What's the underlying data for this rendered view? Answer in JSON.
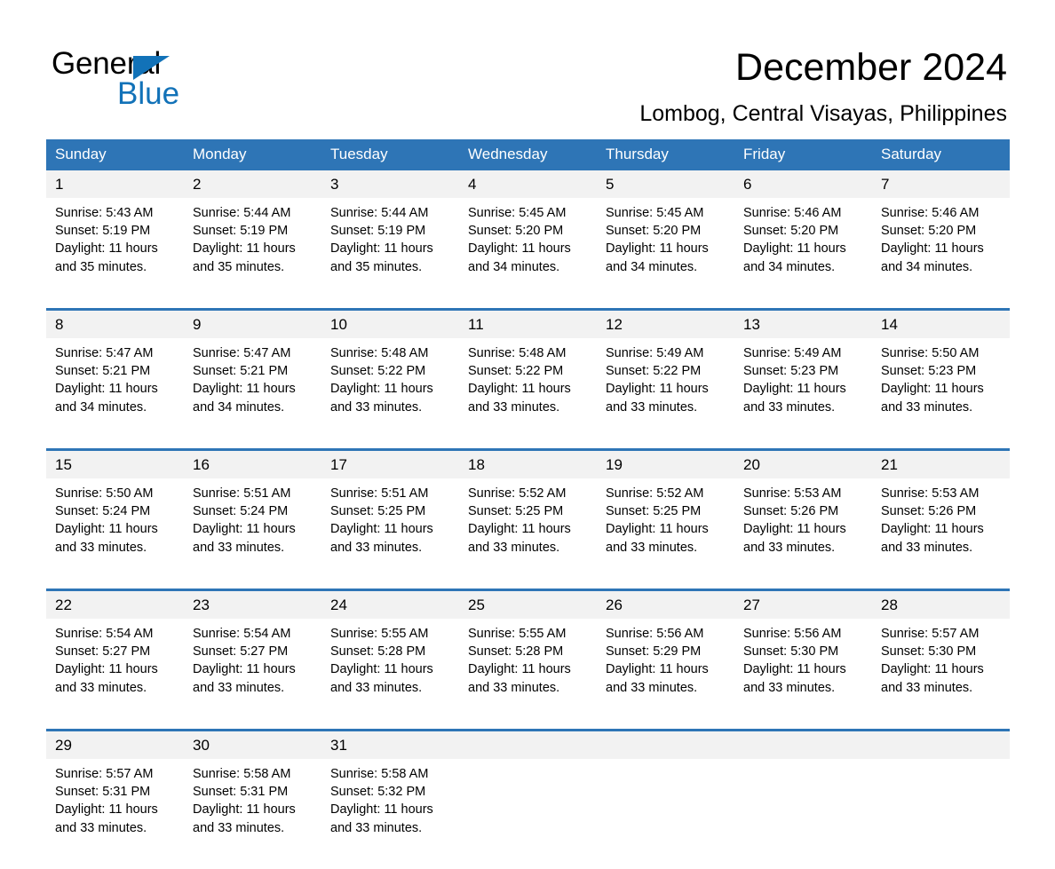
{
  "logo": {
    "word1": "General",
    "word2": "Blue",
    "accent_color": "#1272b8",
    "triangle_icon": "triangle-icon"
  },
  "header": {
    "title": "December 2024",
    "location": "Lombog, Central Visayas, Philippines"
  },
  "theme": {
    "header_blue": "#2e75b6",
    "daynum_band": "#f2f2f2",
    "text": "#000000"
  },
  "calendar": {
    "weekday_headers": [
      "Sunday",
      "Monday",
      "Tuesday",
      "Wednesday",
      "Thursday",
      "Friday",
      "Saturday"
    ],
    "weeks": [
      {
        "days": [
          {
            "num": "1",
            "sunrise": "Sunrise: 5:43 AM",
            "sunset": "Sunset: 5:19 PM",
            "daylight1": "Daylight: 11 hours",
            "daylight2": "and 35 minutes."
          },
          {
            "num": "2",
            "sunrise": "Sunrise: 5:44 AM",
            "sunset": "Sunset: 5:19 PM",
            "daylight1": "Daylight: 11 hours",
            "daylight2": "and 35 minutes."
          },
          {
            "num": "3",
            "sunrise": "Sunrise: 5:44 AM",
            "sunset": "Sunset: 5:19 PM",
            "daylight1": "Daylight: 11 hours",
            "daylight2": "and 35 minutes."
          },
          {
            "num": "4",
            "sunrise": "Sunrise: 5:45 AM",
            "sunset": "Sunset: 5:20 PM",
            "daylight1": "Daylight: 11 hours",
            "daylight2": "and 34 minutes."
          },
          {
            "num": "5",
            "sunrise": "Sunrise: 5:45 AM",
            "sunset": "Sunset: 5:20 PM",
            "daylight1": "Daylight: 11 hours",
            "daylight2": "and 34 minutes."
          },
          {
            "num": "6",
            "sunrise": "Sunrise: 5:46 AM",
            "sunset": "Sunset: 5:20 PM",
            "daylight1": "Daylight: 11 hours",
            "daylight2": "and 34 minutes."
          },
          {
            "num": "7",
            "sunrise": "Sunrise: 5:46 AM",
            "sunset": "Sunset: 5:20 PM",
            "daylight1": "Daylight: 11 hours",
            "daylight2": "and 34 minutes."
          }
        ]
      },
      {
        "days": [
          {
            "num": "8",
            "sunrise": "Sunrise: 5:47 AM",
            "sunset": "Sunset: 5:21 PM",
            "daylight1": "Daylight: 11 hours",
            "daylight2": "and 34 minutes."
          },
          {
            "num": "9",
            "sunrise": "Sunrise: 5:47 AM",
            "sunset": "Sunset: 5:21 PM",
            "daylight1": "Daylight: 11 hours",
            "daylight2": "and 34 minutes."
          },
          {
            "num": "10",
            "sunrise": "Sunrise: 5:48 AM",
            "sunset": "Sunset: 5:22 PM",
            "daylight1": "Daylight: 11 hours",
            "daylight2": "and 33 minutes."
          },
          {
            "num": "11",
            "sunrise": "Sunrise: 5:48 AM",
            "sunset": "Sunset: 5:22 PM",
            "daylight1": "Daylight: 11 hours",
            "daylight2": "and 33 minutes."
          },
          {
            "num": "12",
            "sunrise": "Sunrise: 5:49 AM",
            "sunset": "Sunset: 5:22 PM",
            "daylight1": "Daylight: 11 hours",
            "daylight2": "and 33 minutes."
          },
          {
            "num": "13",
            "sunrise": "Sunrise: 5:49 AM",
            "sunset": "Sunset: 5:23 PM",
            "daylight1": "Daylight: 11 hours",
            "daylight2": "and 33 minutes."
          },
          {
            "num": "14",
            "sunrise": "Sunrise: 5:50 AM",
            "sunset": "Sunset: 5:23 PM",
            "daylight1": "Daylight: 11 hours",
            "daylight2": "and 33 minutes."
          }
        ]
      },
      {
        "days": [
          {
            "num": "15",
            "sunrise": "Sunrise: 5:50 AM",
            "sunset": "Sunset: 5:24 PM",
            "daylight1": "Daylight: 11 hours",
            "daylight2": "and 33 minutes."
          },
          {
            "num": "16",
            "sunrise": "Sunrise: 5:51 AM",
            "sunset": "Sunset: 5:24 PM",
            "daylight1": "Daylight: 11 hours",
            "daylight2": "and 33 minutes."
          },
          {
            "num": "17",
            "sunrise": "Sunrise: 5:51 AM",
            "sunset": "Sunset: 5:25 PM",
            "daylight1": "Daylight: 11 hours",
            "daylight2": "and 33 minutes."
          },
          {
            "num": "18",
            "sunrise": "Sunrise: 5:52 AM",
            "sunset": "Sunset: 5:25 PM",
            "daylight1": "Daylight: 11 hours",
            "daylight2": "and 33 minutes."
          },
          {
            "num": "19",
            "sunrise": "Sunrise: 5:52 AM",
            "sunset": "Sunset: 5:25 PM",
            "daylight1": "Daylight: 11 hours",
            "daylight2": "and 33 minutes."
          },
          {
            "num": "20",
            "sunrise": "Sunrise: 5:53 AM",
            "sunset": "Sunset: 5:26 PM",
            "daylight1": "Daylight: 11 hours",
            "daylight2": "and 33 minutes."
          },
          {
            "num": "21",
            "sunrise": "Sunrise: 5:53 AM",
            "sunset": "Sunset: 5:26 PM",
            "daylight1": "Daylight: 11 hours",
            "daylight2": "and 33 minutes."
          }
        ]
      },
      {
        "days": [
          {
            "num": "22",
            "sunrise": "Sunrise: 5:54 AM",
            "sunset": "Sunset: 5:27 PM",
            "daylight1": "Daylight: 11 hours",
            "daylight2": "and 33 minutes."
          },
          {
            "num": "23",
            "sunrise": "Sunrise: 5:54 AM",
            "sunset": "Sunset: 5:27 PM",
            "daylight1": "Daylight: 11 hours",
            "daylight2": "and 33 minutes."
          },
          {
            "num": "24",
            "sunrise": "Sunrise: 5:55 AM",
            "sunset": "Sunset: 5:28 PM",
            "daylight1": "Daylight: 11 hours",
            "daylight2": "and 33 minutes."
          },
          {
            "num": "25",
            "sunrise": "Sunrise: 5:55 AM",
            "sunset": "Sunset: 5:28 PM",
            "daylight1": "Daylight: 11 hours",
            "daylight2": "and 33 minutes."
          },
          {
            "num": "26",
            "sunrise": "Sunrise: 5:56 AM",
            "sunset": "Sunset: 5:29 PM",
            "daylight1": "Daylight: 11 hours",
            "daylight2": "and 33 minutes."
          },
          {
            "num": "27",
            "sunrise": "Sunrise: 5:56 AM",
            "sunset": "Sunset: 5:30 PM",
            "daylight1": "Daylight: 11 hours",
            "daylight2": "and 33 minutes."
          },
          {
            "num": "28",
            "sunrise": "Sunrise: 5:57 AM",
            "sunset": "Sunset: 5:30 PM",
            "daylight1": "Daylight: 11 hours",
            "daylight2": "and 33 minutes."
          }
        ]
      },
      {
        "days": [
          {
            "num": "29",
            "sunrise": "Sunrise: 5:57 AM",
            "sunset": "Sunset: 5:31 PM",
            "daylight1": "Daylight: 11 hours",
            "daylight2": "and 33 minutes."
          },
          {
            "num": "30",
            "sunrise": "Sunrise: 5:58 AM",
            "sunset": "Sunset: 5:31 PM",
            "daylight1": "Daylight: 11 hours",
            "daylight2": "and 33 minutes."
          },
          {
            "num": "31",
            "sunrise": "Sunrise: 5:58 AM",
            "sunset": "Sunset: 5:32 PM",
            "daylight1": "Daylight: 11 hours",
            "daylight2": "and 33 minutes."
          },
          {
            "num": "",
            "sunrise": "",
            "sunset": "",
            "daylight1": "",
            "daylight2": ""
          },
          {
            "num": "",
            "sunrise": "",
            "sunset": "",
            "daylight1": "",
            "daylight2": ""
          },
          {
            "num": "",
            "sunrise": "",
            "sunset": "",
            "daylight1": "",
            "daylight2": ""
          },
          {
            "num": "",
            "sunrise": "",
            "sunset": "",
            "daylight1": "",
            "daylight2": ""
          }
        ]
      }
    ]
  }
}
